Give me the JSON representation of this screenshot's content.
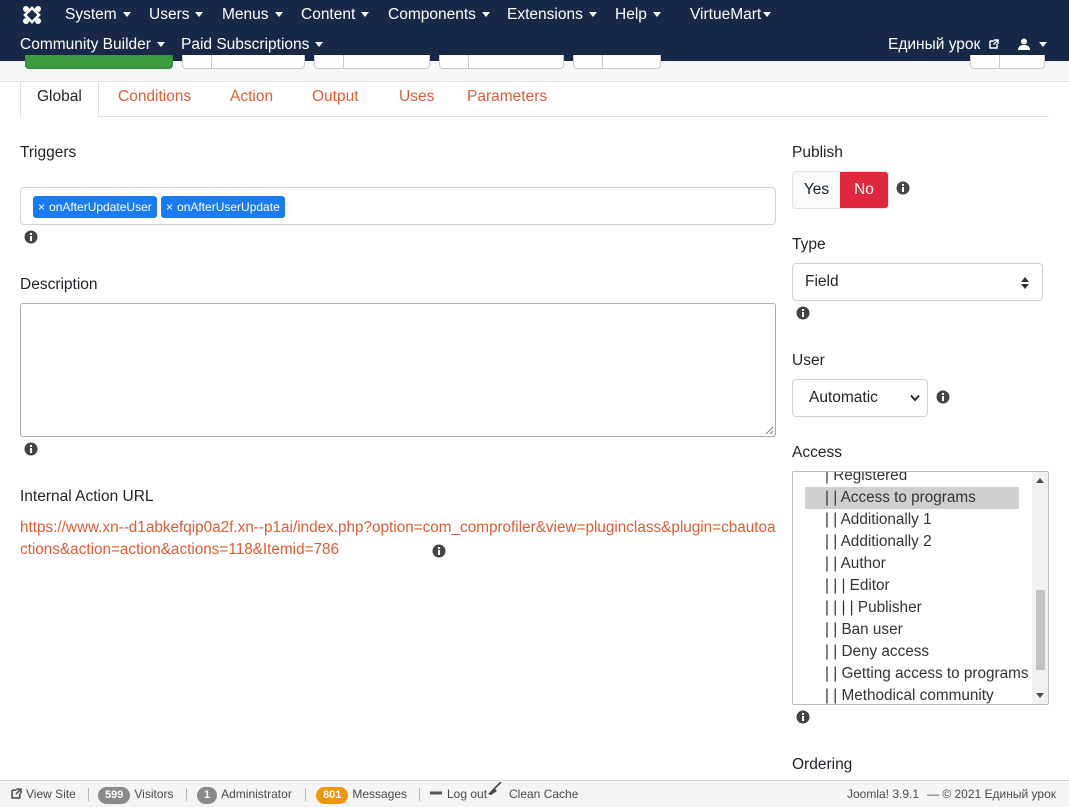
{
  "navbar": {
    "row1": [
      "System",
      "Users",
      "Menus",
      "Content",
      "Components",
      "Extensions",
      "Help",
      "VirtueMart"
    ],
    "row2": [
      "Community Builder",
      "Paid Subscriptions"
    ],
    "site_link": "Единый урок"
  },
  "tabs": [
    "Global",
    "Conditions",
    "Action",
    "Output",
    "Uses",
    "Parameters"
  ],
  "form": {
    "triggers_label": "Triggers",
    "triggers": [
      "onAfterUpdateUser",
      "onAfterUserUpdate"
    ],
    "description_label": "Description",
    "description_value": "",
    "url_label": "Internal Action URL",
    "url": "https://www.xn--d1abkefqip0a2f.xn--p1ai/index.php?option=com_comprofiler&view=pluginclass&plugin=cbautoactions&action=action&actions=118&Itemid=786"
  },
  "side": {
    "publish_label": "Publish",
    "publish_yes": "Yes",
    "publish_no": "No",
    "type_label": "Type",
    "type_value": "Field",
    "user_label": "User",
    "user_value": "Automatic",
    "access_label": "Access",
    "access_options": [
      "| Registered",
      "| | Access to programs",
      "| | Additionally 1",
      "| | Additionally 2",
      "| | Author",
      "| | | Editor",
      "| | | | Publisher",
      "| | Ban user",
      "| | Deny access",
      "| | Getting access to programs",
      "| | Methodical community"
    ],
    "access_selected": "| | Access to programs",
    "ordering_label": "Ordering"
  },
  "statusbar": {
    "view_site": "View Site",
    "visitors_count": "599",
    "visitors_label": "Visitors",
    "admin_count": "1",
    "admin_label": "Administrator",
    "messages_count": "801",
    "messages_label": "Messages",
    "logout": "Log out",
    "clean_cache": "Clean Cache",
    "version": "Joomla! 3.9.1",
    "copyright": "— © 2021 Единый урок"
  },
  "colors": {
    "navbar_bg": "#172848",
    "link": "#dd5d34",
    "tag": "#1b7bf2",
    "publish_no": "#e0283c",
    "messages_badge": "#f0960e"
  }
}
